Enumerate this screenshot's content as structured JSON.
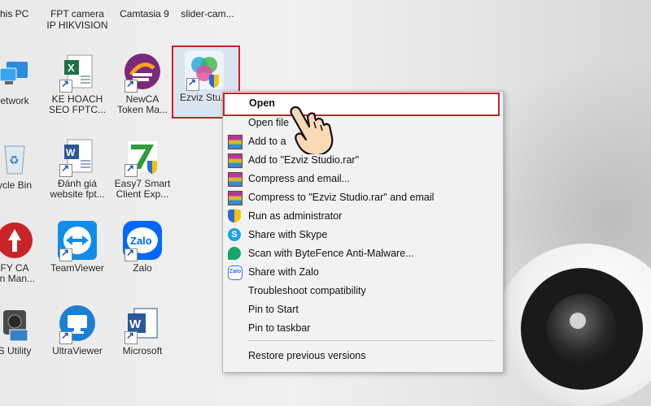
{
  "desktop": {
    "top_labels": [
      "his PC",
      "FPT camera\nIP HIKVISION",
      "Camtasia 9",
      "slider-cam..."
    ],
    "icons": [
      {
        "label": "etwork",
        "icon": "network-icon"
      },
      {
        "label": "KE HOACH\nSEO FPTC...",
        "icon": "excel-file-icon"
      },
      {
        "label": "NewCA\nToken Ma...",
        "icon": "newca-token-icon"
      },
      {
        "label": "Ezviz Stu...",
        "icon": "ezviz-studio-icon"
      },
      {
        "label": "ycle Bin",
        "icon": "recycle-bin-icon"
      },
      {
        "label": "Đánh giá\nwebsite fpt...",
        "icon": "word-file-icon"
      },
      {
        "label": "Easy7 Smart\nClient Exp...",
        "icon": "easy7-icon"
      },
      {
        "label": "FY CA\nen Man...",
        "icon": "fy-ca-icon"
      },
      {
        "label": "TeamViewer",
        "icon": "teamviewer-icon"
      },
      {
        "label": "Zalo",
        "icon": "zalo-icon"
      },
      {
        "label": "S Utility",
        "icon": "utility-icon"
      },
      {
        "label": "UltraViewer",
        "icon": "ultraviewer-icon"
      },
      {
        "label": "Microsoft",
        "icon": "microsoft-word-icon"
      }
    ]
  },
  "context_menu": {
    "items": [
      {
        "label": "Open",
        "icon": ""
      },
      {
        "label": "Open file",
        "icon": ""
      },
      {
        "label": "Add to a",
        "icon": "winrar-icon"
      },
      {
        "label": "Add to \"Ezviz Studio.rar\"",
        "icon": "winrar-icon"
      },
      {
        "label": "Compress and email...",
        "icon": "winrar-icon"
      },
      {
        "label": "Compress to \"Ezviz Studio.rar\" and email",
        "icon": "winrar-icon"
      },
      {
        "label": "Run as administrator",
        "icon": "uac-shield-icon"
      },
      {
        "label": "Share with Skype",
        "icon": "skype-icon"
      },
      {
        "label": "Scan with ByteFence Anti-Malware...",
        "icon": "bytefence-icon"
      },
      {
        "label": "Share with Zalo",
        "icon": "zalo-icon"
      },
      {
        "label": "Troubleshoot compatibility",
        "icon": ""
      },
      {
        "label": "Pin to Start",
        "icon": ""
      },
      {
        "label": "Pin to taskbar",
        "icon": ""
      },
      {
        "label": "Restore previous versions",
        "icon": ""
      }
    ]
  },
  "colors": {
    "highlight_border": "#d11f26",
    "menu_background": "#f2f2f2"
  }
}
